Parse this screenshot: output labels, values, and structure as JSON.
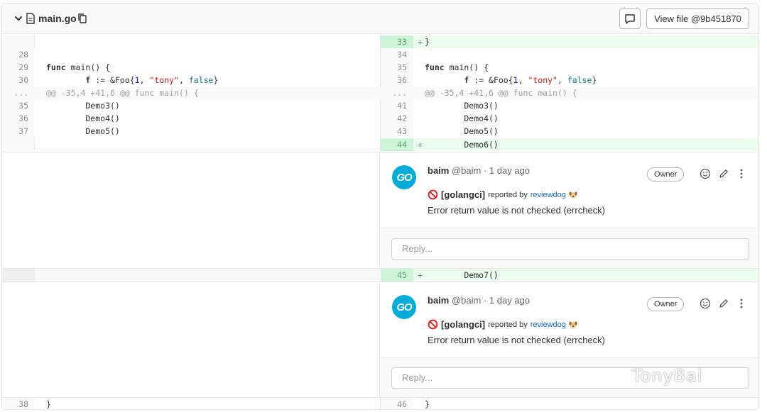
{
  "file": {
    "name": "main.go",
    "view_file_label": "View file @9b451870"
  },
  "icons": {
    "collapse": "chevron-down-icon",
    "file": "file-icon",
    "copy": "copy-icon",
    "comment": "comment-icon",
    "emoji": "smiley-icon",
    "edit": "pencil-icon",
    "more": "ellipsis-v-icon",
    "error": "no-entry-icon",
    "dog": "dog-emoji-icon"
  },
  "colors": {
    "added_bg": "#ecfdf0",
    "added_gutter": "#ccf5d8",
    "avatar": "#00add8",
    "link": "#1068bf"
  },
  "diff": {
    "top_added": {
      "num": "33",
      "sign": "+",
      "text": "}"
    },
    "left_lines": [
      {
        "num": "28",
        "text": ""
      },
      {
        "num": "29",
        "text": "func main() {"
      },
      {
        "num": "30",
        "text": "        f := &Foo{1, \"tony\", false}"
      }
    ],
    "right_lines": [
      {
        "num": "34",
        "text": ""
      },
      {
        "num": "35",
        "text": "func main() {"
      },
      {
        "num": "36",
        "text": "        f := &Foo{1, \"tony\", false}"
      }
    ],
    "expand": {
      "ellipsis": "...",
      "hunk": "@@ -35,4 +41,6 @@ func main() {"
    },
    "left_lines_2": [
      {
        "num": "35",
        "text": "        Demo3()"
      },
      {
        "num": "36",
        "text": "        Demo4()"
      },
      {
        "num": "37",
        "text": "        Demo5()"
      }
    ],
    "right_lines_2": [
      {
        "num": "41",
        "text": "        Demo3()"
      },
      {
        "num": "42",
        "text": "        Demo4()"
      },
      {
        "num": "43",
        "text": "        Demo5()"
      }
    ],
    "added_44": {
      "num": "44",
      "sign": "+",
      "text": "        Demo6()"
    },
    "added_45": {
      "num": "45",
      "sign": "+",
      "text": "        Demo7()"
    },
    "last_left": {
      "num": "38",
      "text": "}"
    },
    "last_right": {
      "num": "46",
      "text": "}"
    }
  },
  "notes": [
    {
      "avatar_text": "GO",
      "author_name": "baim",
      "author_handle": "@baim",
      "time": "· 1 day ago",
      "badge": "Owner",
      "tool": "[golangci]",
      "reported_by": "reported by",
      "reporter": "reviewdog",
      "message": "Error return value is not checked (errcheck)",
      "reply_placeholder": "Reply..."
    },
    {
      "avatar_text": "GO",
      "author_name": "baim",
      "author_handle": "@baim",
      "time": "· 1 day ago",
      "badge": "Owner",
      "tool": "[golangci]",
      "reported_by": "reported by",
      "reporter": "reviewdog",
      "message": "Error return value is not checked (errcheck)",
      "reply_placeholder": "Reply..."
    }
  ],
  "watermark": "TonyBai"
}
